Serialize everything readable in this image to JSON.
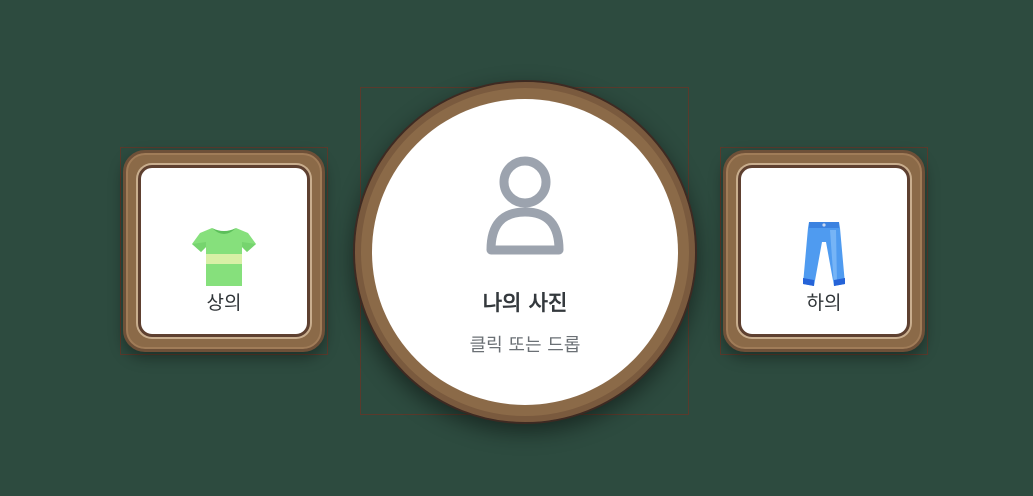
{
  "cards": {
    "top": {
      "label": "상의",
      "icon": "tshirt-icon"
    },
    "bottom": {
      "label": "하의",
      "icon": "jeans-icon"
    }
  },
  "photo": {
    "title": "나의 사진",
    "subtitle": "클릭 또는 드롭",
    "icon": "person-icon"
  },
  "colors": {
    "background": "#2d4b3f",
    "wood": "#8b6a48",
    "wood_dark": "#5e4030",
    "card_face": "#ffffff",
    "icon_gray": "#9ca3ae"
  }
}
